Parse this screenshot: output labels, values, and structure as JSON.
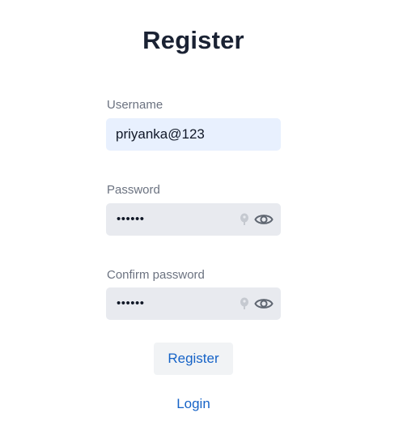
{
  "page": {
    "title": "Register"
  },
  "form": {
    "username": {
      "label": "Username",
      "value": "priyanka@123"
    },
    "password": {
      "label": "Password",
      "masked_value": "••••••",
      "toggle_icon": "eye-icon",
      "autofill_icon": "key-icon"
    },
    "confirm_password": {
      "label": "Confirm password",
      "masked_value": "••••••",
      "toggle_icon": "eye-icon",
      "autofill_icon": "key-icon"
    },
    "submit_label": "Register"
  },
  "footer": {
    "login_label": "Login"
  },
  "colors": {
    "title": "#1a2233",
    "label": "#6b7280",
    "username_bg": "#e8f0fe",
    "password_bg": "#e8eaef",
    "link": "#1663c7",
    "button_bg": "#f1f3f5"
  }
}
